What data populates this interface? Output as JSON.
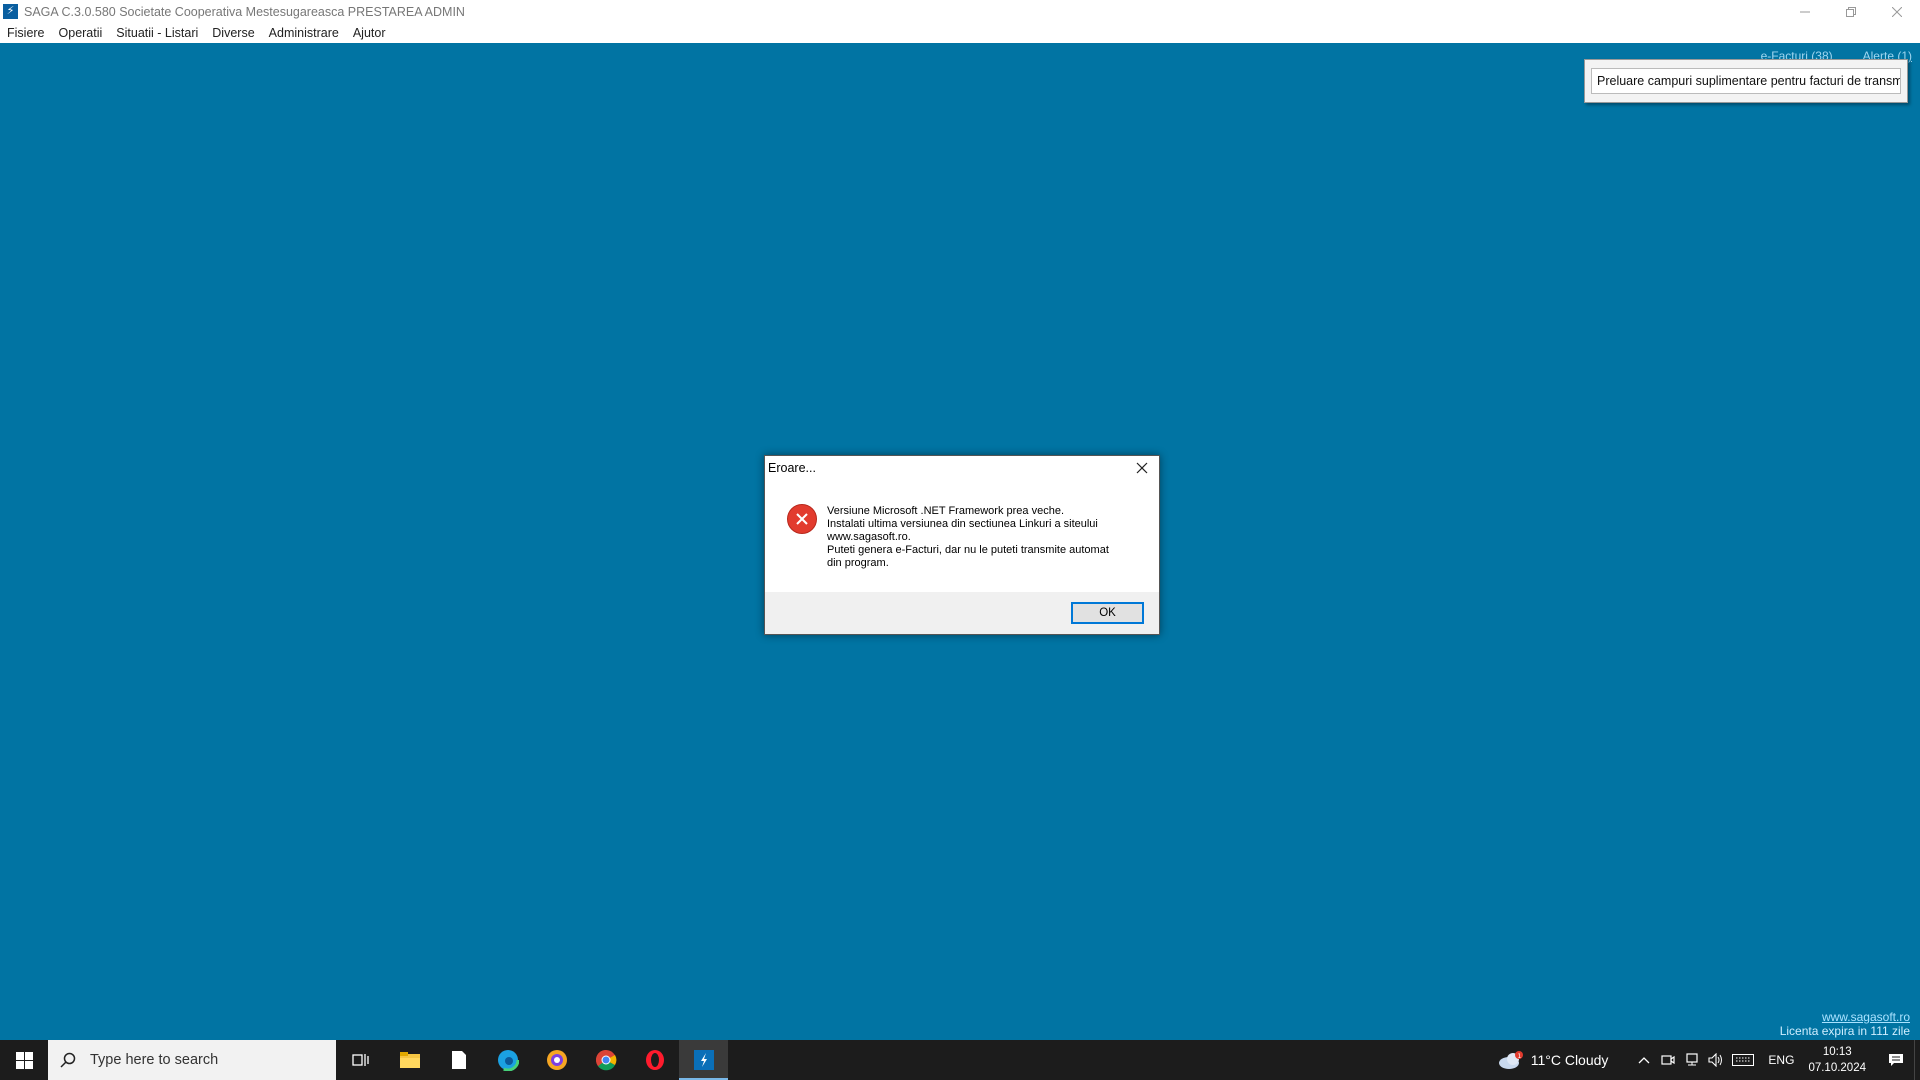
{
  "window": {
    "title": "SAGA C.3.0.580  Societate Cooperativa Mestesugareasca PRESTAREA  ADMIN",
    "app_icon": "saga-icon"
  },
  "menu": {
    "items": [
      "Fisiere",
      "Operatii",
      "Situatii - Listari",
      "Diverse",
      "Administrare",
      "Ajutor"
    ]
  },
  "top_links": {
    "efacturi": "e-Facturi (38)",
    "alerte": "Alerte (1)"
  },
  "tooltip": {
    "text": "Preluare campuri suplimentare pentru facturi de transmis"
  },
  "dialog": {
    "title": "Eroare...",
    "message_lines": [
      "Versiune Microsoft .NET Framework prea veche.",
      "Instalati ultima versiunea din sectiunea Linkuri a siteului",
      "www.sagasoft.ro.",
      "Puteti genera e-Facturi, dar nu le puteti transmite automat",
      "din program."
    ],
    "ok_label": "OK"
  },
  "footer": {
    "site": "www.sagasoft.ro",
    "license": "Licenta expira in 111 zile"
  },
  "taskbar": {
    "search_placeholder": "Type here to search",
    "weather": "11°C  Cloudy",
    "weather_badge": "1",
    "language": "ENG",
    "time": "10:13",
    "date": "07.10.2024"
  },
  "colors": {
    "desktop": "#0174a3",
    "taskbar": "#1c1c1c",
    "error": "#e23b2e",
    "accent": "#0078d7"
  }
}
